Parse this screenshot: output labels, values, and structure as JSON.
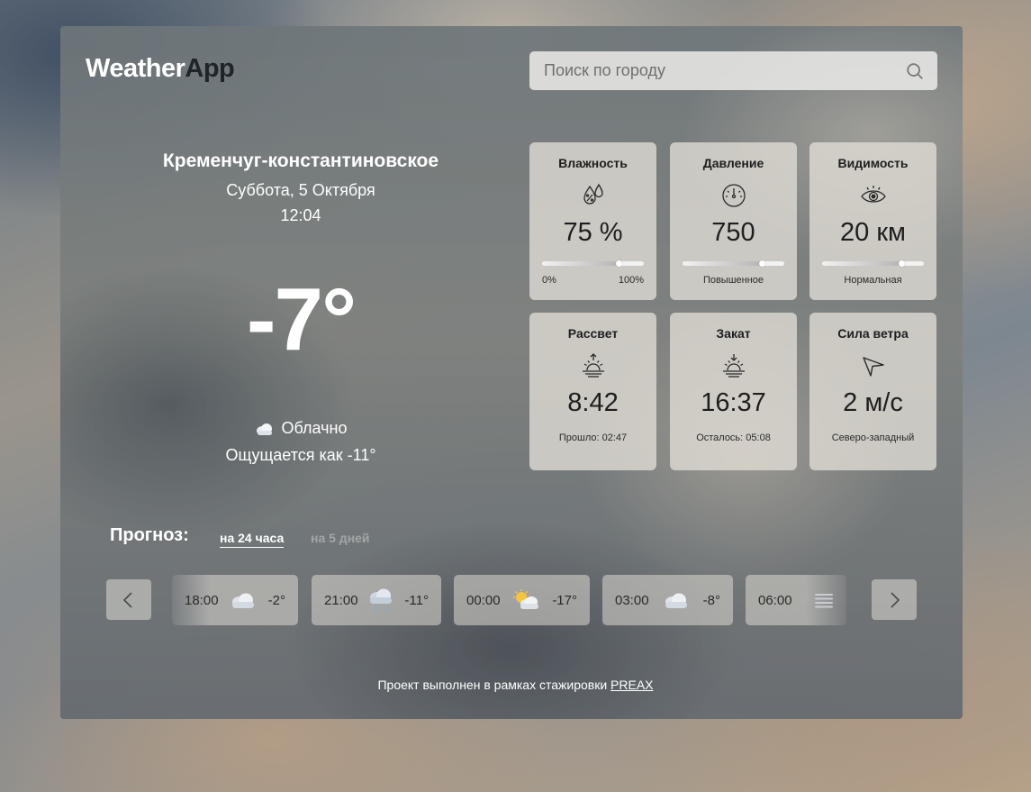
{
  "header": {
    "logo_part1": "Weather",
    "logo_part2": "App",
    "search_placeholder": "Поиск по городу"
  },
  "current": {
    "city": "Кременчуг-константиновское",
    "date": "Суббота, 5 Октября",
    "time": "12:04",
    "temperature": "-7°",
    "condition": "Облачно",
    "condition_icon": "cloud-icon",
    "feels_like": "Ощущается как -11°"
  },
  "cards": {
    "humidity": {
      "title": "Влажность",
      "value": "75 %",
      "min_label": "0%",
      "max_label": "100%",
      "level": 0.75,
      "icon": "humidity-drops-icon"
    },
    "pressure": {
      "title": "Давление",
      "value": "750",
      "note": "Повышенное",
      "level": 0.78,
      "icon": "gauge-icon"
    },
    "visibility": {
      "title": "Видимость",
      "value": "20 км",
      "note": "Нормальная",
      "level": 0.78,
      "icon": "eye-icon"
    },
    "sunrise": {
      "title": "Рассвет",
      "value": "8:42",
      "note": "Прошло: 02:47",
      "icon": "sunrise-icon"
    },
    "sunset": {
      "title": "Закат",
      "value": "16:37",
      "note": "Осталось: 05:08",
      "icon": "sunset-icon"
    },
    "wind": {
      "title": "Сила ветра",
      "value": "2 м/с",
      "note": "Северо-западный",
      "icon": "wind-direction-icon"
    }
  },
  "forecast": {
    "label": "Прогноз:",
    "tabs": [
      "на 24 часа",
      "на 5 дней"
    ],
    "active_tab": "на 24 часа",
    "items": [
      {
        "time": "18:00",
        "icon": "cloud-icon",
        "temp": "-2°"
      },
      {
        "time": "21:00",
        "icon": "snow-cloud-icon",
        "temp": "-11°"
      },
      {
        "time": "00:00",
        "icon": "sun-cloud-icon",
        "temp": "-17°"
      },
      {
        "time": "03:00",
        "icon": "cloud-icon",
        "temp": "-8°"
      },
      {
        "time": "06:00",
        "icon": "fog-icon",
        "temp": ""
      }
    ]
  },
  "footer": {
    "text": "Проект выполнен в рамках стажировки ",
    "link": "PREAX"
  },
  "colors": {
    "card_bg": "#e2ded6",
    "text_light": "#ffffff",
    "text_dark": "#1e1e1e"
  }
}
